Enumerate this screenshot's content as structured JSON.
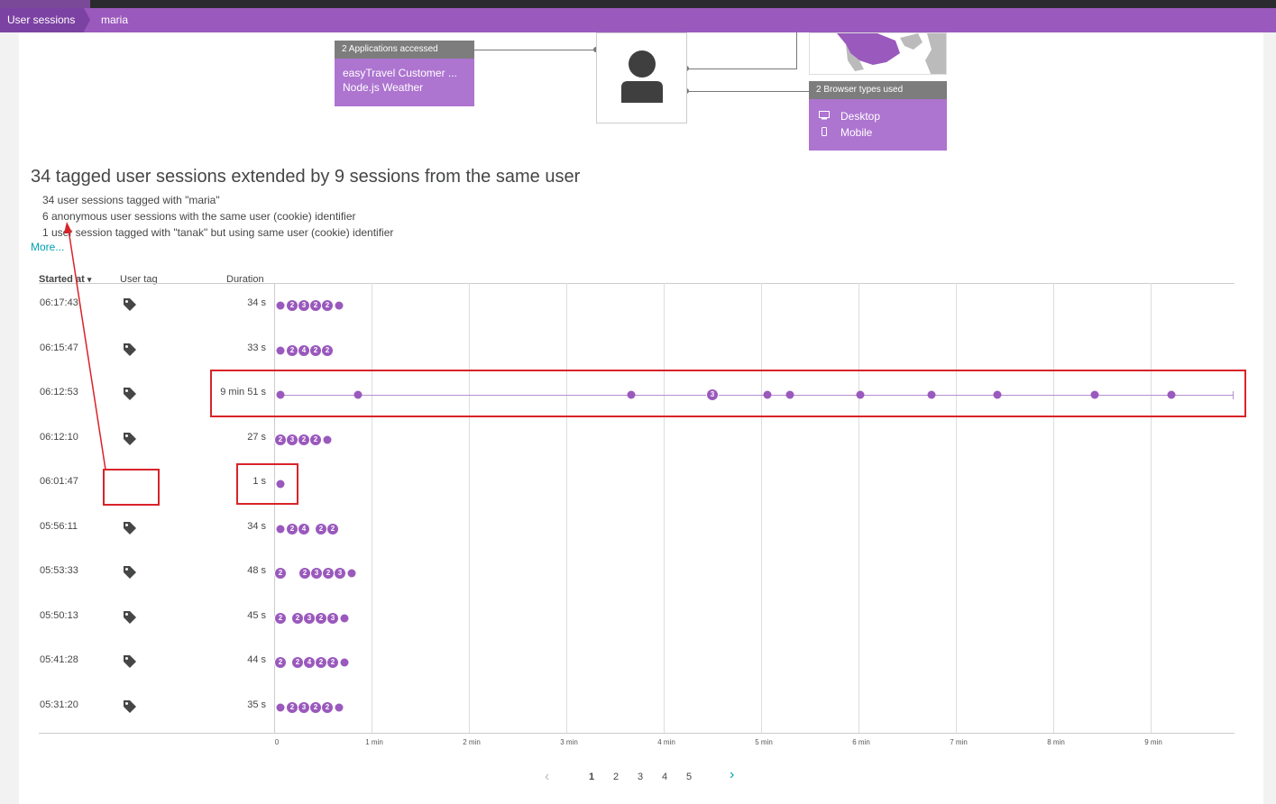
{
  "nav": {
    "breadcrumb_root": "User sessions",
    "breadcrumb_current": "maria"
  },
  "applications": {
    "header": "2 Applications accessed",
    "items": [
      "easyTravel Customer ...",
      "Node.js Weather"
    ]
  },
  "browsers": {
    "header": "2 Browser types used",
    "items": [
      {
        "label": "Desktop",
        "icon": "desktop-icon"
      },
      {
        "label": "Mobile",
        "icon": "mobile-icon"
      }
    ]
  },
  "summary": {
    "title": "34 tagged user sessions extended by 9 sessions from the same user",
    "lines": [
      "34 user sessions tagged with \"maria\"",
      "6 anonymous user sessions with the same user (cookie) identifier",
      "1 user session tagged with \"tanak\" but using same user (cookie) identifier"
    ],
    "more": "More..."
  },
  "table": {
    "headers": {
      "started": "Started at",
      "sort_indicator": "▾",
      "tag": "User tag",
      "duration": "Duration"
    },
    "rows": [
      {
        "start": "06:17:43",
        "tagged": true,
        "duration": "34 s"
      },
      {
        "start": "06:15:47",
        "tagged": true,
        "duration": "33 s"
      },
      {
        "start": "06:12:53",
        "tagged": true,
        "duration": "9 min 51 s"
      },
      {
        "start": "06:12:10",
        "tagged": true,
        "duration": "27 s"
      },
      {
        "start": "06:01:47",
        "tagged": false,
        "duration": "1 s"
      },
      {
        "start": "05:56:11",
        "tagged": true,
        "duration": "34 s"
      },
      {
        "start": "05:53:33",
        "tagged": true,
        "duration": "48 s"
      },
      {
        "start": "05:50:13",
        "tagged": true,
        "duration": "45 s"
      },
      {
        "start": "05:41:28",
        "tagged": true,
        "duration": "44 s"
      },
      {
        "start": "05:31:20",
        "tagged": true,
        "duration": "35 s"
      }
    ],
    "axis_ticks": [
      "0",
      "1 min",
      "2 min",
      "3 min",
      "4 min",
      "5 min",
      "6 min",
      "7 min",
      "8 min",
      "9 min"
    ]
  },
  "pagination": {
    "pages": [
      "1",
      "2",
      "3",
      "4",
      "5"
    ],
    "current": "1",
    "prev": "‹",
    "next": "›"
  },
  "colors": {
    "accent": "#9a59bd",
    "highlight": "#d9232a",
    "link": "#00a1b2"
  }
}
